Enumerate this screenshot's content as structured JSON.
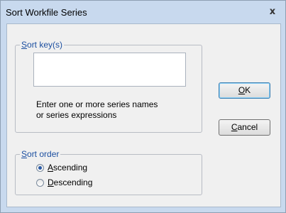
{
  "window": {
    "title": "Sort Workfile Series",
    "close_glyph": "x"
  },
  "sort_keys": {
    "legend_key": "S",
    "legend_rest": "ort key(s)",
    "value": "",
    "hint_lines": [
      "Enter one or more series names",
      "or series expressions"
    ]
  },
  "sort_order": {
    "legend_key": "S",
    "legend_rest": "ort order",
    "options": [
      {
        "key": "A",
        "rest": "scending",
        "checked": true
      },
      {
        "key": "D",
        "rest": "escending",
        "checked": false
      }
    ]
  },
  "buttons": {
    "ok_key": "O",
    "ok_rest": "K",
    "cancel_key": "C",
    "cancel_rest": "ancel"
  }
}
